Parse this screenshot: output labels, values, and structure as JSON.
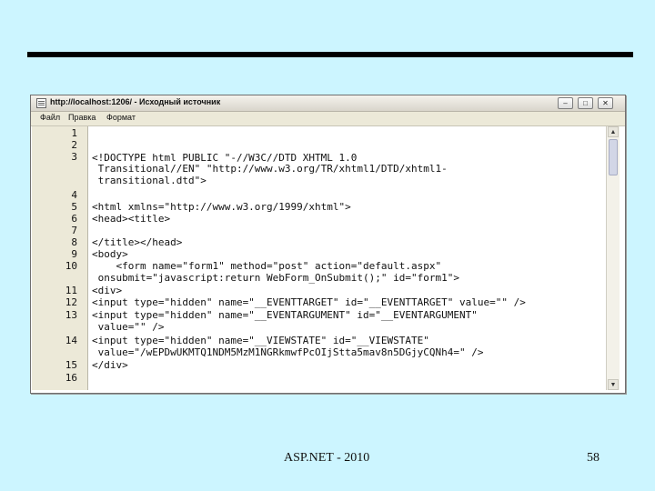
{
  "window": {
    "title": "http://localhost:1206/ - Исходный источник",
    "buttons": {
      "minimize": "–",
      "maximize": "□",
      "close": "✕"
    }
  },
  "menu": [
    "Файл",
    "Правка",
    "Формат"
  ],
  "code": {
    "line_numbers": [
      "1",
      "2",
      "3",
      "4",
      "5",
      "6",
      "7",
      "8",
      "9",
      "10",
      "11",
      "12",
      "13",
      "14",
      "15",
      "16"
    ],
    "lines": [
      "<!DOCTYPE html PUBLIC \"-//W3C//DTD XHTML 1.0",
      " Transitional//EN\" \"http://www.w3.org/TR/xhtml1/DTD/xhtml1-",
      " transitional.dtd\">",
      "<html xmlns=\"http://www.w3.org/1999/xhtml\">",
      "<head><title>",
      "</title></head>",
      "<body>",
      "    <form name=\"form1\" method=\"post\" action=\"default.aspx\"",
      " onsubmit=\"javascript:return WebForm_OnSubmit();\" id=\"form1\">",
      "<div>",
      "<input type=\"hidden\" name=\"__EVENTTARGET\" id=\"__EVENTTARGET\" value=\"\" />",
      "<input type=\"hidden\" name=\"__EVENTARGUMENT\" id=\"__EVENTARGUMENT\"",
      " value=\"\" />",
      "<input type=\"hidden\" name=\"__VIEWSTATE\" id=\"__VIEWSTATE\"",
      " value=\"/wEPDwUKMTQ1NDM5MzM1NGRkmwfPcOIjStta5mav8n5DGjyCQNh4=\" />",
      "</div>"
    ]
  },
  "footer": {
    "left": "ASP.NET - 2010",
    "right": "58"
  }
}
